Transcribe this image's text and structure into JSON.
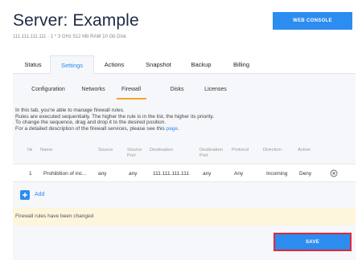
{
  "server": {
    "title": "Server: Example",
    "meta": "111.111.111.111 · 1 * 3 GHz  512 Mb RAM  10 Gb Disk"
  },
  "web_console_label": "WEB CONSOLE",
  "main_tabs": [
    {
      "label": "Status",
      "active": false
    },
    {
      "label": "Settings",
      "active": true
    },
    {
      "label": "Actions",
      "active": false
    },
    {
      "label": "Snapshot",
      "active": false
    },
    {
      "label": "Backup",
      "active": false
    },
    {
      "label": "Billing",
      "active": false
    }
  ],
  "sub_tabs": [
    {
      "label": "Configuration",
      "active": false
    },
    {
      "label": "Networks",
      "active": false
    },
    {
      "label": "Firewall",
      "active": true
    },
    {
      "label": "Disks",
      "active": false
    },
    {
      "label": "Licenses",
      "active": false
    }
  ],
  "info": {
    "line1": "In this tab, you're able to manage firewall rules.",
    "line2": "Rules are executed sequentially. The higher the rule is in the list, the higher its priority.",
    "line3": "To change the sequence, drag and drop it to the desired position.",
    "line4_prefix": "For a detailed description of the firewall services, please see this",
    "line4_link": "page",
    "line4_suffix": "."
  },
  "table": {
    "columns": {
      "num": "№",
      "name": "Name",
      "source": "Source",
      "source_port_1": "Source",
      "source_port_2": "Port",
      "destination": "Destination",
      "dest_port_1": "Destination",
      "dest_port_2": "Port",
      "protocol": "Protocol",
      "direction": "Direction",
      "action": "Action"
    },
    "rows": [
      {
        "num": "1",
        "name": "Prohibition of inc...",
        "source": "any",
        "source_port": "any",
        "destination": "111.111.111.111",
        "destination_port": "any",
        "protocol": "Any",
        "direction": "Incoming",
        "action": "Deny",
        "remove_icon": "circle-x-icon"
      }
    ]
  },
  "add_label": "Add",
  "notice": "Firewall rules have been changed",
  "save_label": "SAVE",
  "colors": {
    "accent": "#2d8cf0",
    "save_outline": "#e0283a",
    "tab_underline": "#f5a623",
    "notice_bg": "#fdf5dc",
    "panel_bg": "#f5f7fa"
  }
}
